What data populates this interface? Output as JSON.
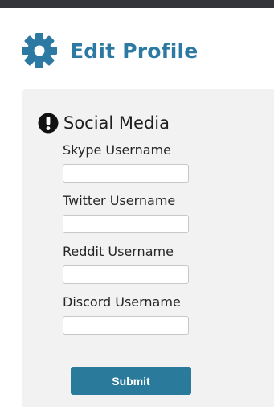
{
  "header": {
    "title": "Edit Profile",
    "icon": "gear-icon",
    "accent_color": "#2c7aa3"
  },
  "section": {
    "title": "Social Media",
    "icon": "exclamation-circle-icon"
  },
  "fields": [
    {
      "label": "Skype Username",
      "value": "",
      "placeholder": ""
    },
    {
      "label": "Twitter Username",
      "value": "",
      "placeholder": ""
    },
    {
      "label": "Reddit Username",
      "value": "",
      "placeholder": ""
    },
    {
      "label": "Discord Username",
      "value": "",
      "placeholder": ""
    }
  ],
  "submit": {
    "label": "Submit",
    "color": "#2a7b9b"
  }
}
